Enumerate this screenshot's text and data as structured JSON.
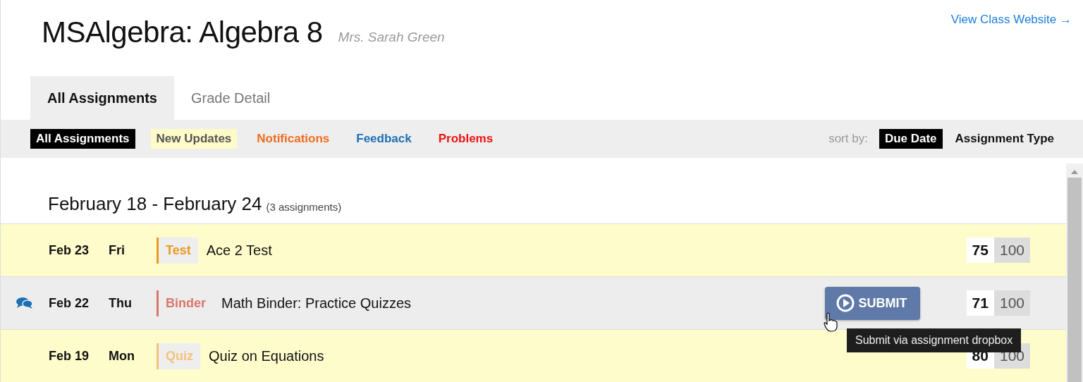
{
  "header": {
    "title_bold": "MSAlgebra",
    "title_rest": ": Algebra 8",
    "teacher": "Mrs. Sarah Green",
    "website_link": "View Class Website",
    "link_arrow": "→"
  },
  "tabs": [
    {
      "label": "All Assignments",
      "selected": true
    },
    {
      "label": "Grade Detail",
      "selected": false
    }
  ],
  "filters": [
    {
      "label": "All Assignments",
      "selected": true,
      "color": "#000000"
    },
    {
      "label": "New Updates",
      "selected": false,
      "color": "#555555"
    },
    {
      "label": "Notifications",
      "selected": false,
      "color": "#f26b1d"
    },
    {
      "label": "Feedback",
      "selected": false,
      "color": "#1a6fb5"
    },
    {
      "label": "Problems",
      "selected": false,
      "color": "#ee1111"
    }
  ],
  "sort": {
    "label": "sort by:",
    "options": [
      {
        "label": "Due Date",
        "selected": true
      },
      {
        "label": "Assignment Type",
        "selected": false
      }
    ]
  },
  "week": {
    "title": "February 18 - February 24",
    "count": "(3 assignments)"
  },
  "assignments": [
    {
      "date": "Feb 23",
      "day": "Fri",
      "type": "Test",
      "color": "#eb9a1e",
      "title": "Ace 2 Test",
      "score": "75",
      "max": "100",
      "hovered": false,
      "has_feedback": false
    },
    {
      "date": "Feb 22",
      "day": "Thu",
      "type": "Binder",
      "color": "#d9776b",
      "title": "Math Binder: Practice Quizzes",
      "score": "71",
      "max": "100",
      "hovered": true,
      "has_feedback": true,
      "submit": "SUBMIT",
      "tooltip": "Submit via assignment dropbox"
    },
    {
      "date": "Feb 19",
      "day": "Mon",
      "type": "Quiz",
      "color": "#f5c27a",
      "title": "Quiz on Equations",
      "score": "80",
      "max": "100",
      "hovered": false,
      "has_feedback": false
    }
  ]
}
